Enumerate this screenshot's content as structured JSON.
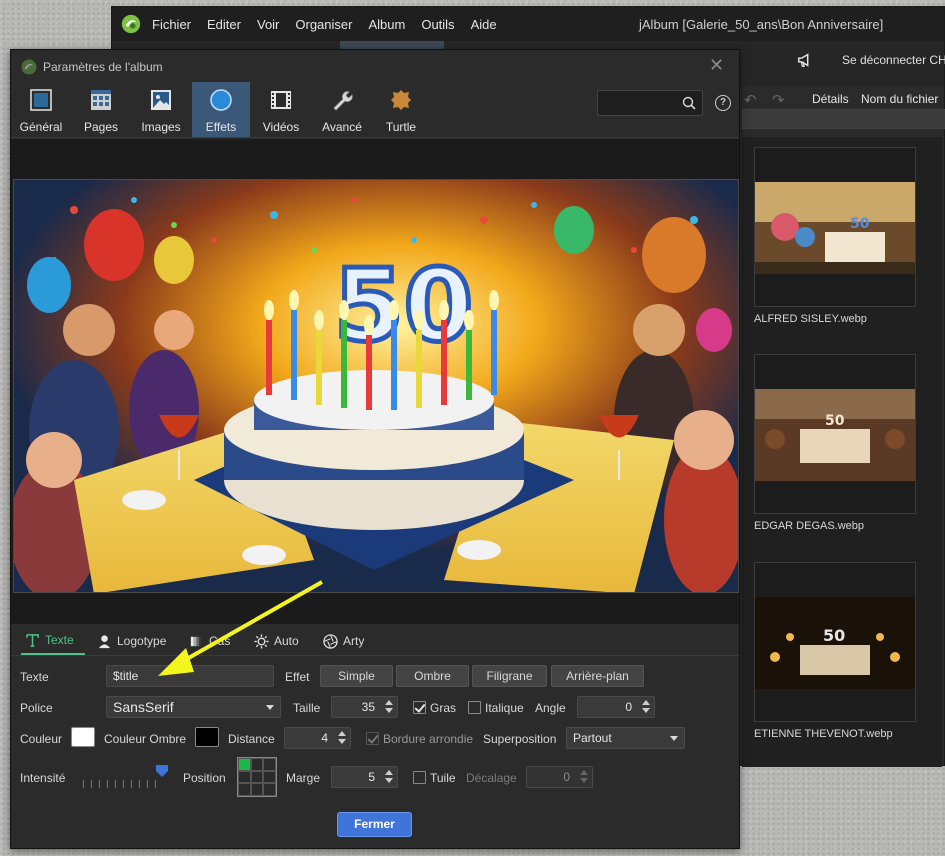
{
  "main_window": {
    "menu": [
      "Fichier",
      "Editer",
      "Voir",
      "Organiser",
      "Album",
      "Outils",
      "Aide"
    ],
    "title": "jAlbum [Galerie_50_ans\\Bon Anniversaire]",
    "logout_label": "Se déconnecter CHA",
    "details_label": "Détails",
    "filename_label": "Nom du fichier",
    "thumbnails": [
      {
        "name": "ALFRED SISLEY.webp"
      },
      {
        "name": "EDGAR DEGAS.webp"
      },
      {
        "name": "ETIENNE THEVENOT.webp"
      }
    ]
  },
  "dialog": {
    "title": "Paramètres de l'album",
    "categories": [
      {
        "label": "Général",
        "icon": "monitor-icon"
      },
      {
        "label": "Pages",
        "icon": "grid-page-icon"
      },
      {
        "label": "Images",
        "icon": "picture-icon"
      },
      {
        "label": "Effets",
        "icon": "circle-icon",
        "active": true
      },
      {
        "label": "Vidéos",
        "icon": "film-icon"
      },
      {
        "label": "Avancé",
        "icon": "wrench-icon"
      },
      {
        "label": "Turtle",
        "icon": "turtle-hide-icon"
      }
    ],
    "help_label": "?",
    "sub_tabs": [
      "Texte",
      "Logotype",
      "Cas",
      "Auto",
      "Arty"
    ],
    "form": {
      "texte_label": "Texte",
      "texte_value": "$title",
      "effet_label": "Effet",
      "effet_buttons": [
        "Simple",
        "Ombre",
        "Filigrane",
        "Arrière-plan"
      ],
      "police_label": "Police",
      "police_value": "SansSerif",
      "taille_label": "Taille",
      "taille_value": "35",
      "gras_label": "Gras",
      "gras_checked": true,
      "italique_label": "Italique",
      "italique_checked": false,
      "angle_label": "Angle",
      "angle_value": "0",
      "couleur_label": "Couleur",
      "couleur_color": "#ffffff",
      "couleur_ombre_label": "Couleur Ombre",
      "couleur_ombre_color": "#000000",
      "distance_label": "Distance",
      "distance_value": "4",
      "bordure_label": "Bordure arrondie",
      "bordure_checked": true,
      "superposition_label": "Superposition",
      "superposition_value": "Partout",
      "intensite_label": "Intensité",
      "intensite_level": 1.0,
      "position_label": "Position",
      "position_selected": "top-left",
      "marge_label": "Marge",
      "marge_value": "5",
      "tuile_label": "Tuile",
      "tuile_checked": false,
      "decalage_label": "Décalage",
      "decalage_value": "0",
      "close_label": "Fermer"
    }
  },
  "colors": {
    "accent": "#4fc18a",
    "active_category": "#3c5878",
    "primary_button": "#3f74d9",
    "annotation_arrow": "#f5f51e"
  }
}
